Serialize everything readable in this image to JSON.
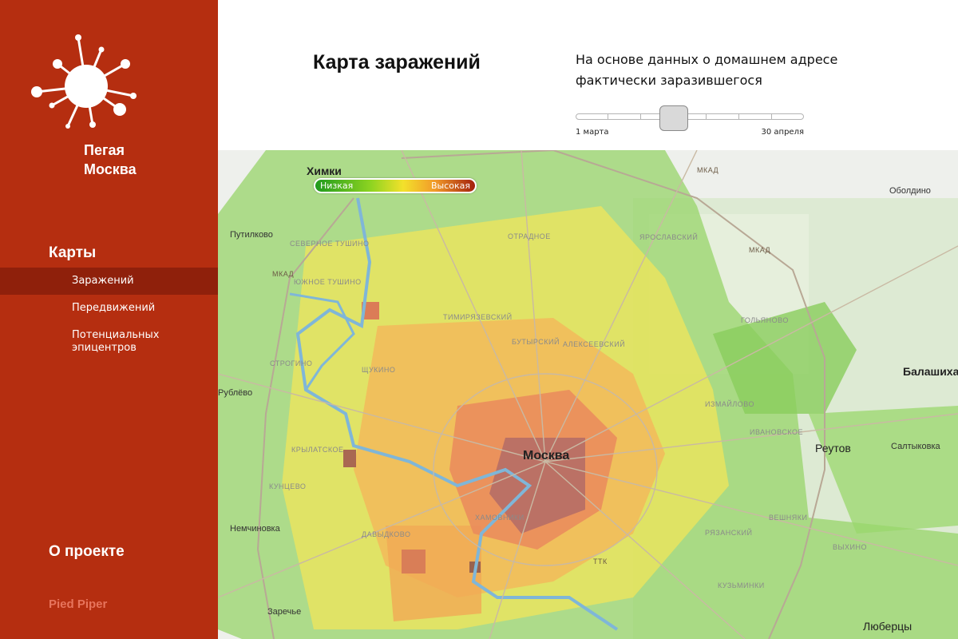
{
  "sidebar": {
    "brand_line1": "Пегая",
    "brand_line2": "Москва",
    "section_title": "Карты",
    "nav": [
      {
        "label": "Заражений",
        "active": true
      },
      {
        "label": "Передвижений",
        "active": false
      },
      {
        "label": "Потенциальных эпицентров",
        "active": false
      }
    ],
    "about": "О проекте",
    "footer_brand": "Pied Piper"
  },
  "header": {
    "title": "Карта заражений",
    "description": "На основе данных о домашнем адресе фактически заразившегося",
    "slider": {
      "start_label": "1 марта",
      "end_label": "30 апреля",
      "value_fraction": 0.43
    }
  },
  "map": {
    "legend": {
      "low": "Низкая",
      "high": "Высокая"
    },
    "places": {
      "khimki": "Химки",
      "moscow": "Москва",
      "reutov": "Реутов",
      "balashikha": "Балашиха",
      "lyubertsy": "Люберцы",
      "putilkovo": "Путилково",
      "rublevo": "Рублёво",
      "nemchinovka": "Немчиновка",
      "oboldino": "Оболдино",
      "saltykovka": "Салтыковка",
      "mkad": "МКАД",
      "sev_tushino": "СЕВЕРНОЕ ТУШИНО",
      "yuzh_tushino": "ЮЖНОЕ ТУШИНО",
      "strogino": "СТРОГИНО",
      "shchukino": "ЩУКИНО",
      "timiryazevsky": "ТИМИРЯЗЕВСКИЙ",
      "butyrsky": "БУТЫРСКИЙ",
      "alekseevsky": "АЛЕКСЕЕВСКИЙ",
      "yaroslavsky": "ЯРОСЛАВСКИЙ",
      "otradnoe": "ОТРАДНОЕ",
      "golyanovo": "ГОЛЬЯНОВО",
      "izmaylovo": "ИЗМАЙЛОВО",
      "ivanovskoe": "ИВАНОВСКОЕ",
      "kuntsevo": "КУНЦЕВО",
      "krylatskoe": "КРЫЛАТСКОЕ",
      "davydkovo": "ДАВЫДКОВО",
      "khamovniki": "ХАМОВНИКИ",
      "ryazansky": "РЯЗАНСКИЙ",
      "veshnyaki": "ВЕШНЯКИ",
      "vykhino": "ВЫХИНО",
      "kuzminki": "КУЗЬМИНКИ",
      "zarechye": "Заречье",
      "ttk": "ТТК"
    }
  },
  "colors": {
    "sidebar_bg": "#b52e10",
    "sidebar_active": "#8f200b",
    "footer_brand": "#e7745c"
  }
}
